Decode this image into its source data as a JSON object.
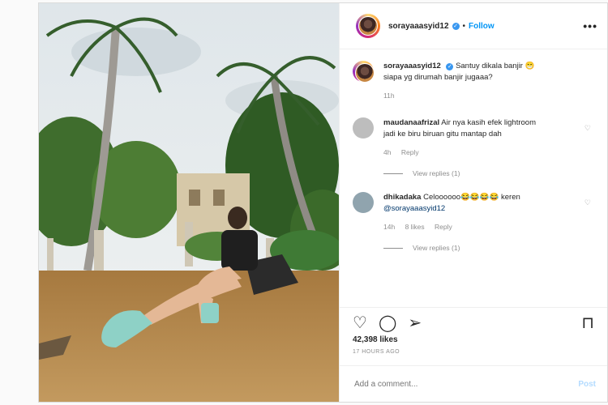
{
  "post": {
    "username": "sorayaaasyid12",
    "follow_label": "Follow",
    "more_label": "•••",
    "caption_text": "Santuy dikala banjir 😁 siapa yg dirumah banjir jugaaa?",
    "caption_time": "11h",
    "likes": "42,398 likes",
    "timestamp": "17 HOURS AGO",
    "comment_placeholder": "Add a comment...",
    "post_label": "Post"
  },
  "comments": [
    {
      "username": "maudanaafrizal",
      "text": "Air nya kasih efek lightroom jadi ke biru biruan gitu mantap dah",
      "time": "4h",
      "reply_label": "Reply",
      "view_replies": "View replies (1)",
      "avatar_color": "#bdbdbd"
    },
    {
      "username": "dhikadaka",
      "text": "Celoooooo😂😂😂😂 keren",
      "mention": "@sorayaaasyid12",
      "time": "14h",
      "likes": "8 likes",
      "reply_label": "Reply",
      "view_replies": "View replies (1)",
      "avatar_color": "#90a4ae"
    }
  ],
  "colors": {
    "accent": "#0095f6",
    "verified": "#3897f0",
    "muted": "#8e8e8e"
  },
  "icons": [
    "heart-icon",
    "comment-icon",
    "share-icon",
    "bookmark-icon"
  ]
}
